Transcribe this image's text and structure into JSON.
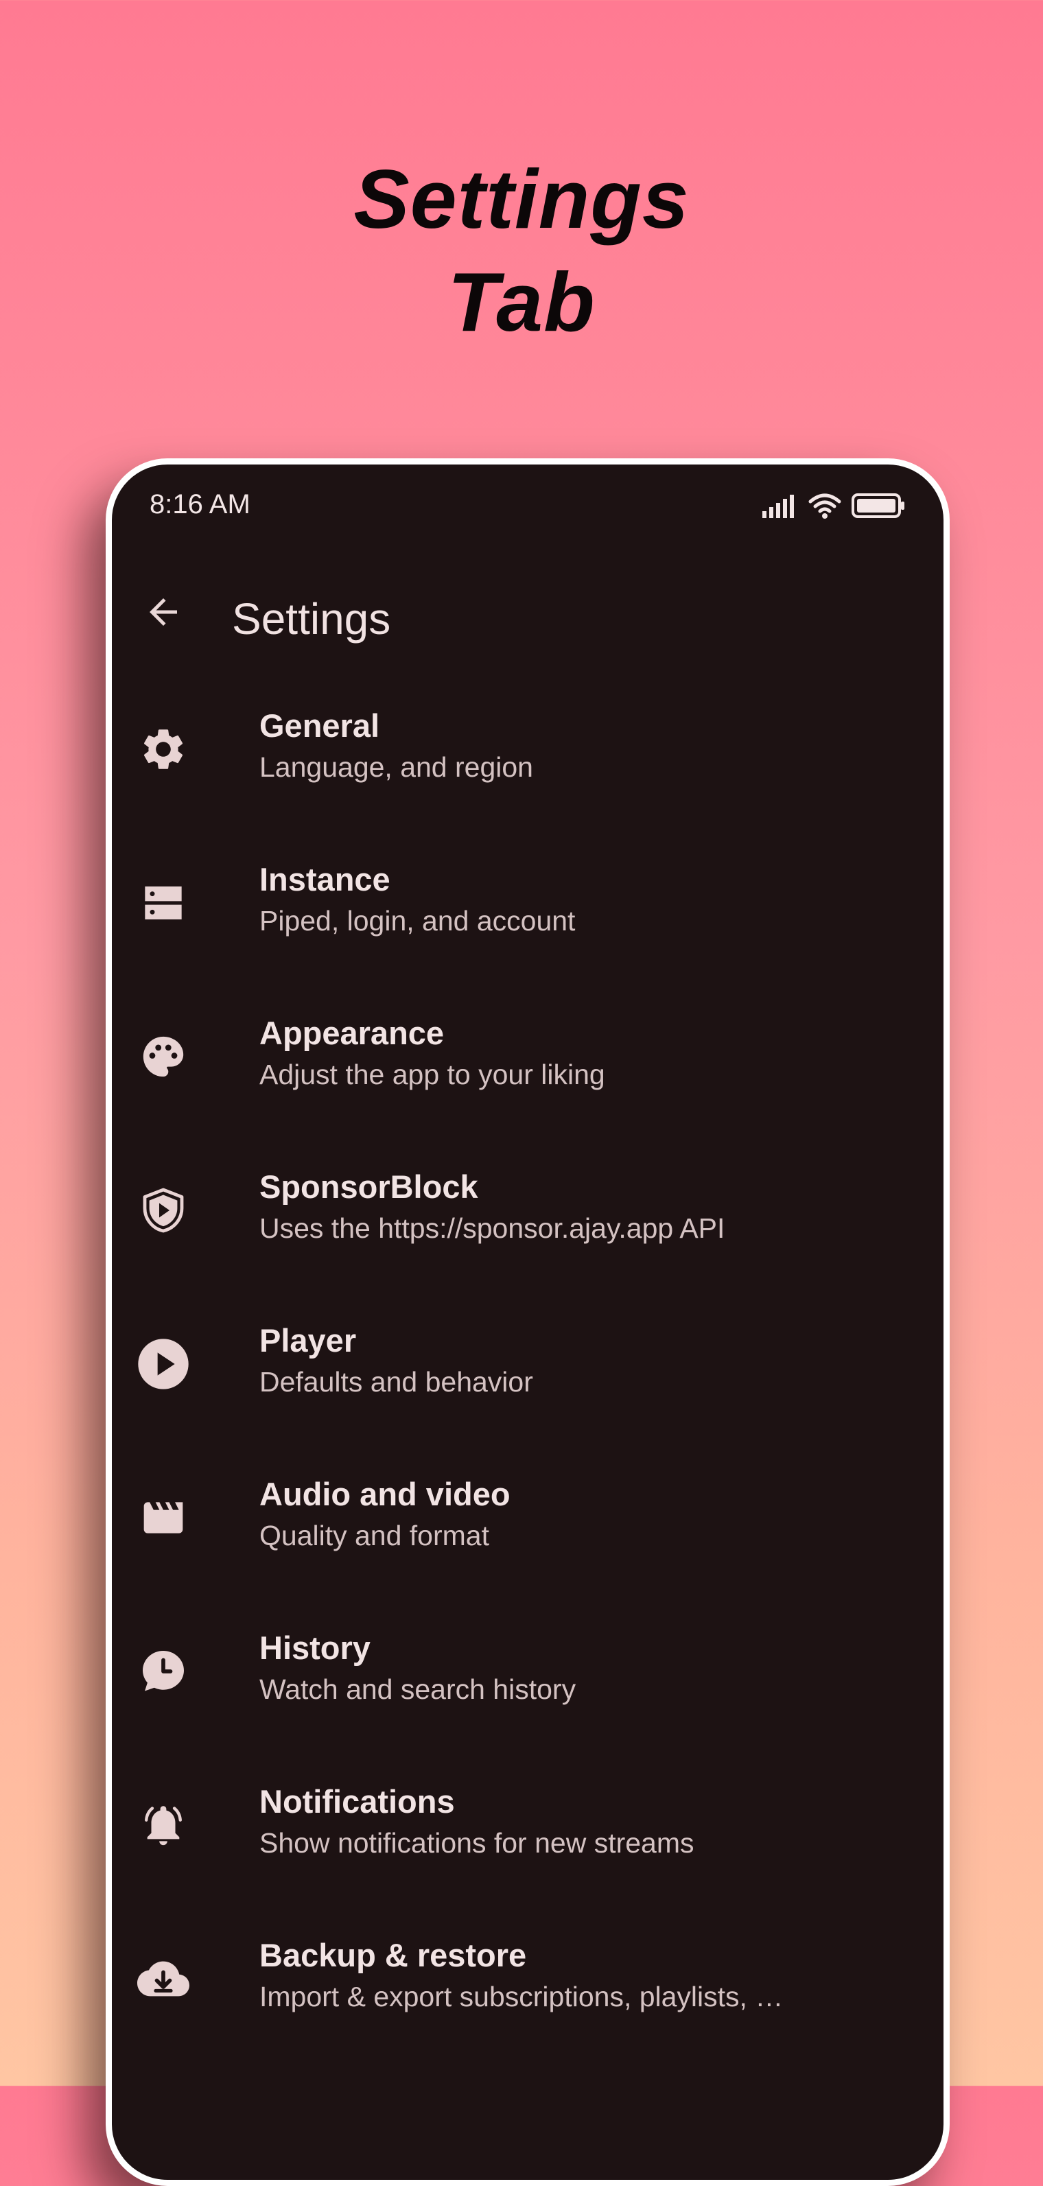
{
  "promo": {
    "title_line1": "Settings",
    "title_line2": "Tab"
  },
  "status_bar": {
    "time": "8:16 AM",
    "icons": [
      "signal-icon",
      "wifi-icon",
      "battery-icon"
    ]
  },
  "app_bar": {
    "back_icon": "arrow-back-icon",
    "title": "Settings"
  },
  "settings": {
    "items": [
      {
        "title": "General",
        "subtitle": "Language, and region",
        "icon": "gear-icon"
      },
      {
        "title": "Instance",
        "subtitle": "Piped, login, and account",
        "icon": "server-icon"
      },
      {
        "title": "Appearance",
        "subtitle": "Adjust the app to your liking",
        "icon": "palette-icon"
      },
      {
        "title": "SponsorBlock",
        "subtitle": "Uses the https://sponsor.ajay.app API",
        "icon": "shield-play-icon"
      },
      {
        "title": "Player",
        "subtitle": "Defaults and behavior",
        "icon": "play-circle-icon"
      },
      {
        "title": "Audio and video",
        "subtitle": "Quality and format",
        "icon": "clapperboard-icon"
      },
      {
        "title": "History",
        "subtitle": "Watch and search history",
        "icon": "history-icon"
      },
      {
        "title": "Notifications",
        "subtitle": "Show notifications for new streams",
        "icon": "bell-icon"
      },
      {
        "title": "Backup & restore",
        "subtitle": "Import & export subscriptions, playlists, …",
        "icon": "cloud-download-icon"
      }
    ]
  },
  "colors": {
    "background_top": "#ff7a92",
    "background_bottom": "#ffc6a3",
    "screen_background": "#1d1213",
    "icon_color": "#e8d3d3",
    "title_color": "#f2e4e4",
    "subtitle_color": "#d4c2c2"
  }
}
